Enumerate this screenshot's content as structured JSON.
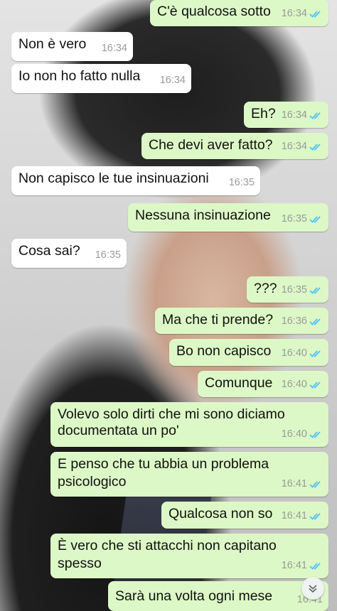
{
  "messages": [
    {
      "dir": "out",
      "text": "C'è qualcosa sotto",
      "time": "16:34"
    },
    {
      "dir": "in",
      "text": "Non è vero",
      "time": "16:34"
    },
    {
      "dir": "in",
      "text": "Io non ho fatto nulla",
      "time": "16:34"
    },
    {
      "dir": "out",
      "text": "Eh?",
      "time": "16:34"
    },
    {
      "dir": "out",
      "text": "Che devi aver fatto?",
      "time": "16:34"
    },
    {
      "dir": "in",
      "text": "Non capisco le tue insinuazioni",
      "time": "16:35"
    },
    {
      "dir": "out",
      "text": "Nessuna insinuazione",
      "time": "16:35"
    },
    {
      "dir": "in",
      "text": "Cosa sai?",
      "time": "16:35"
    },
    {
      "dir": "out",
      "text": "???",
      "time": "16:35"
    },
    {
      "dir": "out",
      "text": "Ma che ti prende?",
      "time": "16:36"
    },
    {
      "dir": "out",
      "text": "Bo non capisco",
      "time": "16:40"
    },
    {
      "dir": "out",
      "text": "Comunque",
      "time": "16:40"
    },
    {
      "dir": "out",
      "text": "Volevo solo dirti che mi sono diciamo",
      "text2": "documentata un po'",
      "time": "16:40"
    },
    {
      "dir": "out",
      "text": "E penso che tu abbia un problema",
      "text2": "psicologico",
      "time": "16:41"
    },
    {
      "dir": "out",
      "text": "Qualcosa non so",
      "time": "16:41"
    },
    {
      "dir": "out",
      "text": "È vero che sti attacchi non capitano",
      "text2": "spesso",
      "time": "16:41"
    },
    {
      "dir": "out",
      "text": "Sarà una volta ogni mese",
      "time": "16:41"
    }
  ],
  "colors": {
    "incoming_bubble": "#ffffff",
    "outgoing_bubble": "#dcf8c6",
    "read_ticks": "#4fc3f7",
    "timestamp": "#9a9a9a"
  },
  "icons": {
    "read_receipt": "double-check-icon",
    "scroll_down": "chevron-down-icon"
  }
}
